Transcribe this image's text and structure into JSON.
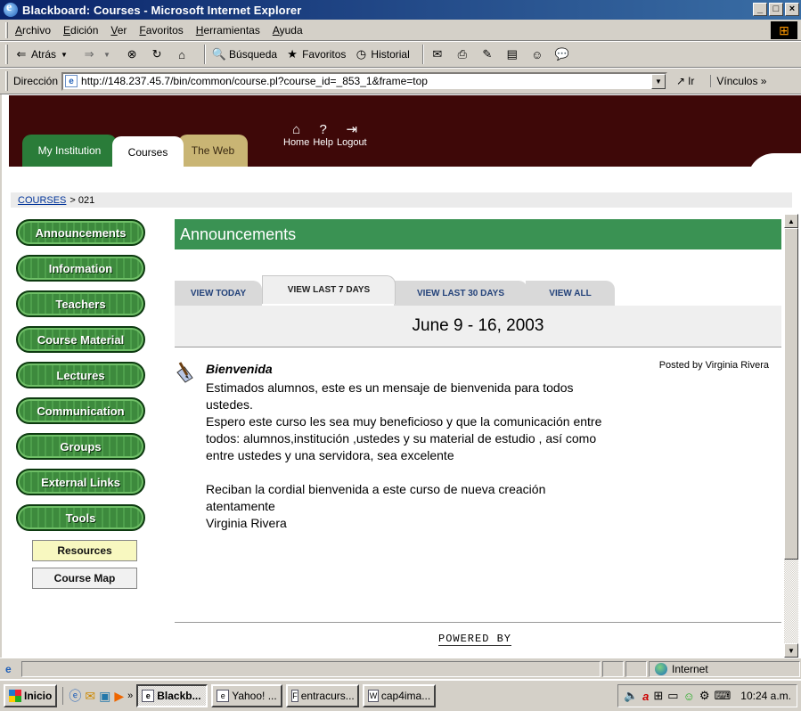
{
  "window": {
    "title": "Blackboard: Courses - Microsoft Internet Explorer",
    "buttons": [
      "_",
      "□",
      "×"
    ]
  },
  "menu": [
    "Archivo",
    "Edición",
    "Ver",
    "Favoritos",
    "Herramientas",
    "Ayuda"
  ],
  "toolbar": {
    "back": "Atrás",
    "search": "Búsqueda",
    "favorites": "Favoritos",
    "history": "Historial"
  },
  "address": {
    "label": "Dirección",
    "url": "http://148.237.45.7/bin/common/course.pl?course_id=_853_1&frame=top",
    "go": "Ir",
    "links": "Vínculos"
  },
  "header": {
    "tabs": [
      "My Institution",
      "Courses",
      "The Web"
    ],
    "icons": [
      "Home",
      "Help",
      "Logout"
    ]
  },
  "breadcrumb": {
    "link": "COURSES",
    "separator": ">",
    "current": "021"
  },
  "nav": {
    "buttons": [
      "Announcements",
      "Information",
      "Teachers",
      "Course Material",
      "Lectures",
      "Communication",
      "Groups",
      "External Links",
      "Tools"
    ],
    "plain": [
      "Resources",
      "Course Map"
    ]
  },
  "content": {
    "title": "Announcements",
    "date_tabs": [
      "VIEW TODAY",
      "VIEW LAST 7 DAYS",
      "VIEW LAST 30 DAYS",
      "VIEW ALL"
    ],
    "active_tab": "VIEW LAST 7 DAYS",
    "date_range": "June 9 - 16, 2003",
    "announcement": {
      "title": "Bienvenida",
      "posted_by": "Posted by Virginia Rivera",
      "lines": [
        "Estimados alumnos, este es un mensaje de bienvenida para todos",
        "ustedes.",
        "Espero este curso les sea muy beneficioso y que la comunicación entre",
        "todos: alumnos,institución ,ustedes y su material de estudio , así como",
        "entre ustedes y una servidora, sea excelente",
        "",
        "Reciban la cordial bienvenida a este curso de nueva creación",
        "atentamente",
        "Virginia Rivera"
      ]
    },
    "footer": "POWERED BY"
  },
  "status": {
    "zone": "Internet"
  },
  "taskbar": {
    "start": "Inicio",
    "tasks": [
      "Blackb...",
      "Yahoo! ...",
      "entracurs...",
      "cap4ima..."
    ],
    "clock": "10:24 a.m."
  },
  "colors": {
    "header_bg": "#3e0808",
    "content_header": "#3a9253",
    "nav_green": "#3d8a3d",
    "titlebar": "#0a246a"
  }
}
